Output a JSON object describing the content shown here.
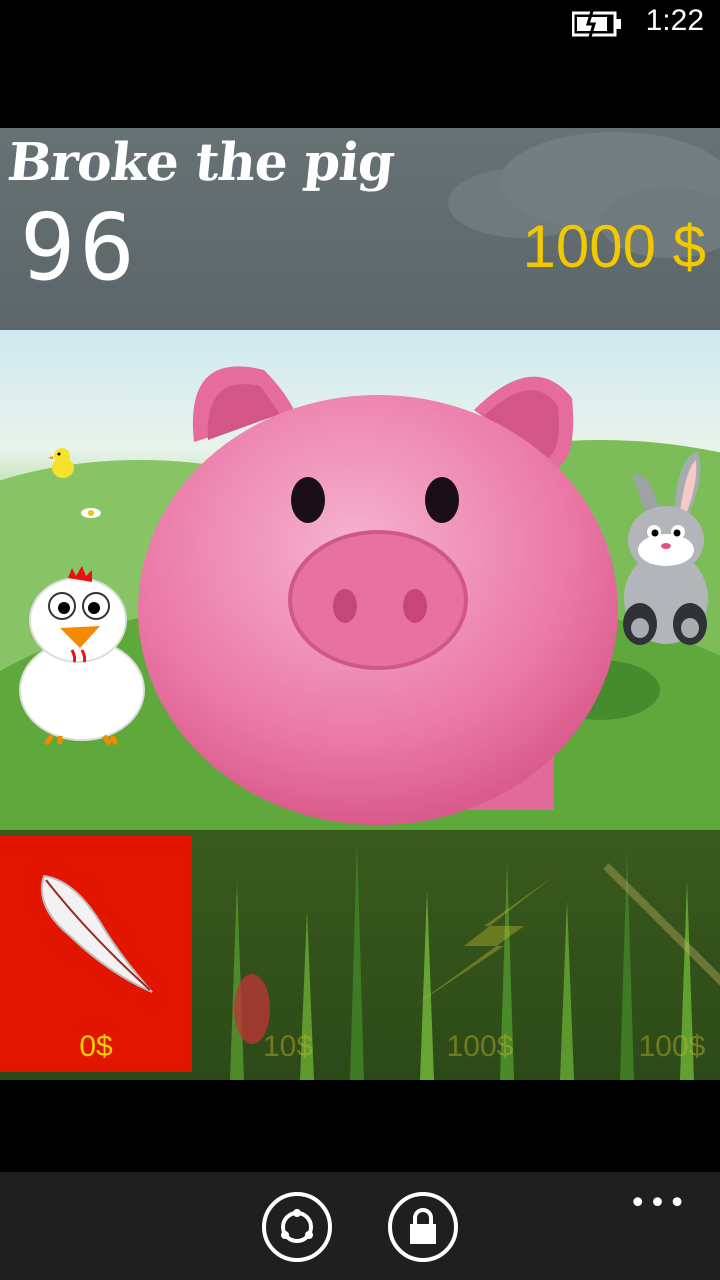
{
  "status": {
    "time": "1:22",
    "battery_icon": "battery-charging-icon"
  },
  "header": {
    "title": "Broke the pig",
    "counter": "96",
    "money": "1000 $"
  },
  "scene": {
    "characters": [
      "piggy-bank",
      "chicken",
      "chick",
      "rabbit",
      "daisy-flower"
    ]
  },
  "shop": {
    "items": [
      {
        "name": "feather",
        "price": "0$",
        "selected": true
      },
      {
        "name": "easter-egg",
        "price": "10$",
        "selected": false
      },
      {
        "name": "lightning",
        "price": "100$",
        "selected": false
      },
      {
        "name": "wand",
        "price": "100$",
        "selected": false
      }
    ]
  },
  "app_bar": {
    "buttons": [
      "refresh-icon",
      "lock-icon"
    ],
    "more": "•••"
  },
  "colors": {
    "money": "#f2c800",
    "selected_item": "#e11500",
    "pig": "#ea78a6"
  }
}
